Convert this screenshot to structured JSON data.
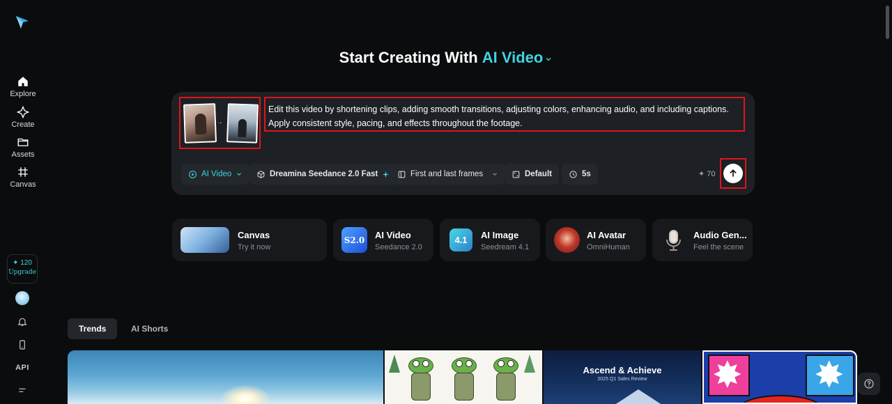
{
  "sidebar": {
    "items": [
      {
        "label": "Explore",
        "icon": "home-icon"
      },
      {
        "label": "Create",
        "icon": "diamond-sparkle-icon"
      },
      {
        "label": "Assets",
        "icon": "folder-icon"
      },
      {
        "label": "Canvas",
        "icon": "frame-icon"
      }
    ],
    "credits": "120",
    "upgrade_label": "Upgrade",
    "api_label": "API"
  },
  "header": {
    "title": "Start Creating With",
    "mode": "AI Video"
  },
  "prompt": {
    "text": "Edit this video by shortening clips, adding smooth transitions, adjusting colors, enhancing audio, and including captions. Apply consistent style, pacing, and effects throughout the footage.",
    "toolbar": {
      "mode_label": "AI Video",
      "model_label": "Dreamina Seedance 2.0 Fast",
      "frames_label": "First and last frames",
      "ratio_label": "Default",
      "duration_label": "5s"
    },
    "cost": "70"
  },
  "features": [
    {
      "title": "Canvas",
      "subtitle": "Try it now"
    },
    {
      "title": "AI Video",
      "subtitle": "Seedance 2.0"
    },
    {
      "title": "AI Image",
      "subtitle": "Seedream 4.1"
    },
    {
      "title": "AI Avatar",
      "subtitle": "OmniHuman"
    },
    {
      "title": "Audio Gen...",
      "subtitle": "Feel the scene"
    }
  ],
  "feature_icon_text": {
    "video": "S2.0",
    "image": "4.1"
  },
  "tabs": [
    {
      "label": "Trends",
      "active": true
    },
    {
      "label": "AI Shorts",
      "active": false
    }
  ],
  "gallery": {
    "card3_title": "Ascend & Achieve",
    "card3_subtitle": "2025 Q1 Sales Review"
  },
  "colors": {
    "accent": "#3fd4e0",
    "highlight_border": "#e0141b",
    "background": "#0b0c0e",
    "card": "#1d2024"
  }
}
